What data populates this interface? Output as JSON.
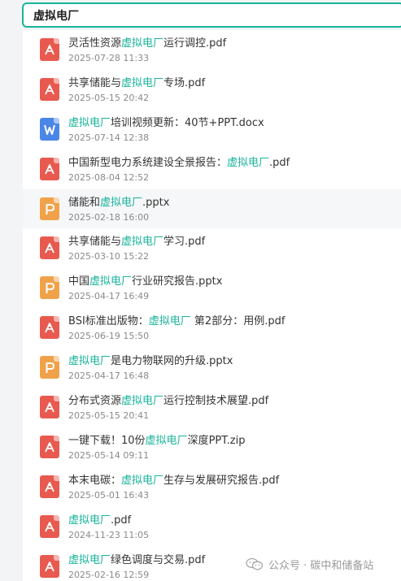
{
  "search": {
    "value": "虚拟电厂",
    "keyword": "虚拟电厂"
  },
  "colors": {
    "accent": "#19b39a",
    "pdf": "#e85a4f",
    "ppt": "#f0a24a",
    "doc": "#4a86e8"
  },
  "files": [
    {
      "parts": [
        "灵活性资源",
        "虚拟电厂",
        "运行调控.pdf"
      ],
      "date": "2025-07-28 11:33",
      "icon": "pdf-icon",
      "type": "pdf"
    },
    {
      "parts": [
        "共享储能与",
        "虚拟电厂",
        "专场.pdf"
      ],
      "date": "2025-05-15 20:42",
      "icon": "pdf-icon",
      "type": "pdf"
    },
    {
      "parts": [
        "",
        "虚拟电厂",
        "培训视频更新：40节+PPT.docx"
      ],
      "date": "2025-07-14 12:38",
      "icon": "word-icon",
      "type": "doc"
    },
    {
      "parts": [
        "中国新型电力系统建设全景报告：",
        "虚拟电厂",
        ".pdf"
      ],
      "date": "2025-08-04 12:52",
      "icon": "pdf-icon",
      "type": "pdf"
    },
    {
      "parts": [
        "储能和",
        "虚拟电厂",
        ".pptx"
      ],
      "date": "2025-02-18 16:00",
      "icon": "ppt-icon",
      "type": "ppt"
    },
    {
      "parts": [
        "共享储能与",
        "虚拟电厂",
        "学习.pdf"
      ],
      "date": "2025-03-10 15:22",
      "icon": "pdf-icon",
      "type": "pdf"
    },
    {
      "parts": [
        "中国",
        "虚拟电厂",
        "行业研究报告.pptx"
      ],
      "date": "2025-04-17 16:49",
      "icon": "ppt-icon",
      "type": "ppt"
    },
    {
      "parts": [
        "BSI标准出版物：",
        "虚拟电厂",
        " 第2部分：用例.pdf"
      ],
      "date": "2025-06-19 15:50",
      "icon": "pdf-icon",
      "type": "pdf"
    },
    {
      "parts": [
        "",
        "虚拟电厂",
        "是电力物联网的升级.pptx"
      ],
      "date": "2025-04-17 16:48",
      "icon": "ppt-icon",
      "type": "ppt"
    },
    {
      "parts": [
        "分布式资源",
        "虚拟电厂",
        "运行控制技术展望.pdf"
      ],
      "date": "2025-05-15 20:41",
      "icon": "pdf-icon",
      "type": "pdf"
    },
    {
      "parts": [
        "一键下载！10份",
        "虚拟电厂",
        "深度PPT.zip"
      ],
      "date": "2025-05-14 09:11",
      "icon": "pdf-icon",
      "type": "pdf"
    },
    {
      "parts": [
        "本末电碳：",
        "虚拟电厂",
        "生存与发展研究报告.pdf"
      ],
      "date": "2025-05-01 16:43",
      "icon": "pdf-icon",
      "type": "pdf"
    },
    {
      "parts": [
        "",
        "虚拟电厂",
        ".pdf"
      ],
      "date": "2024-11-23 11:05",
      "icon": "pdf-icon",
      "type": "pdf"
    },
    {
      "parts": [
        "",
        "虚拟电厂",
        "绿色调度与交易.pdf"
      ],
      "date": "2025-02-16 12:59",
      "icon": "pdf-icon",
      "type": "pdf"
    }
  ],
  "highlighted_row": 4,
  "watermark": {
    "text": "公众号 · 碳中和储备站",
    "icon": "wechat-icon"
  }
}
